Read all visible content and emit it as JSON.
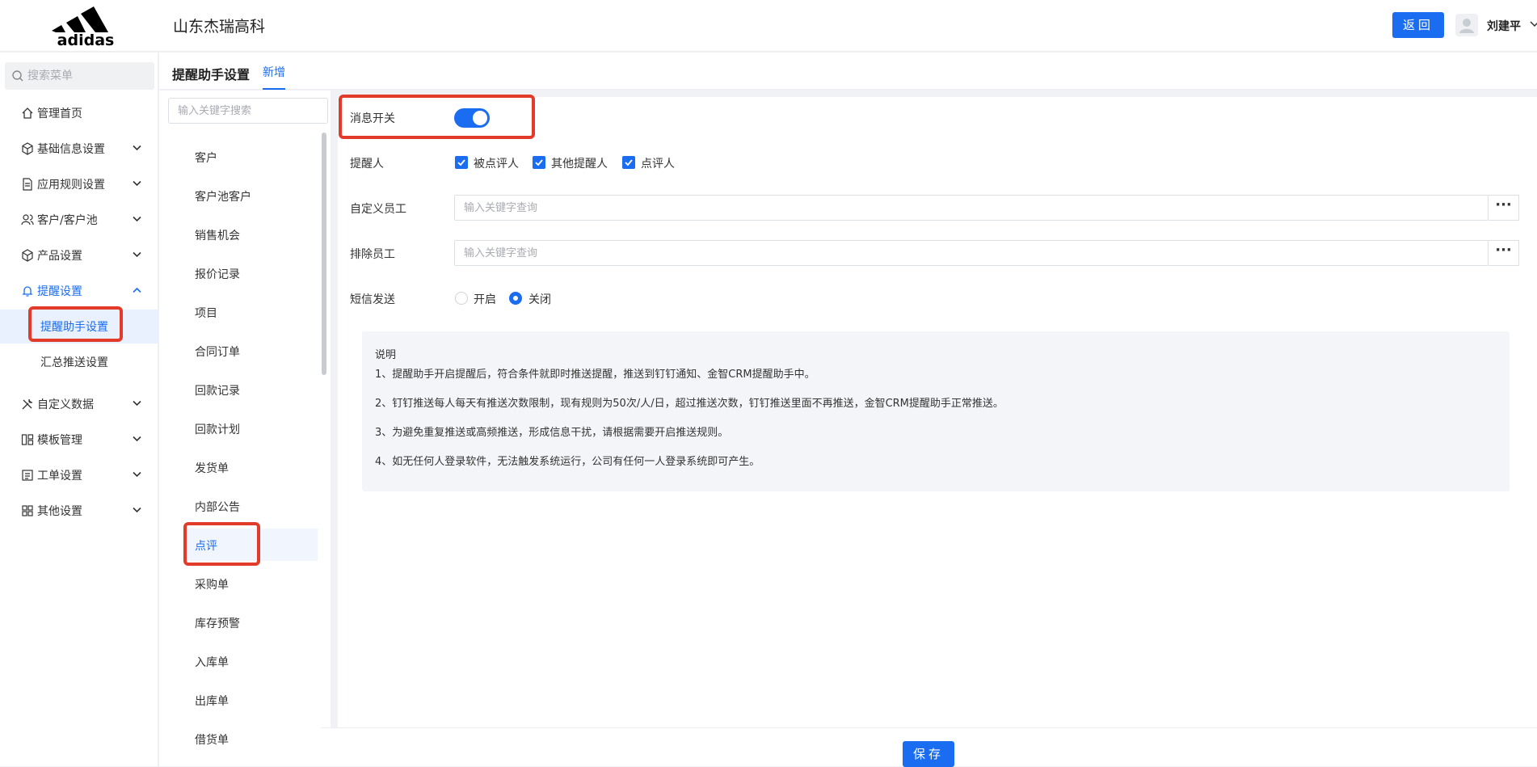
{
  "brand": {
    "logo_text": "adidas",
    "company": "山东杰瑞高科",
    "accent_color": "#1a6cf0"
  },
  "header": {
    "back_label": "返回",
    "user_name": "刘建平"
  },
  "sidebar": {
    "search_placeholder": "搜索菜单",
    "items": [
      {
        "label": "管理首页",
        "icon": "home-icon"
      },
      {
        "label": "基础信息设置",
        "icon": "cube-icon"
      },
      {
        "label": "应用规则设置",
        "icon": "document-icon"
      },
      {
        "label": "客户/客户池",
        "icon": "users-icon"
      },
      {
        "label": "产品设置",
        "icon": "box-icon"
      },
      {
        "label": "提醒设置",
        "icon": "bell-icon"
      },
      {
        "label": "自定义数据",
        "icon": "tools-icon"
      },
      {
        "label": "模板管理",
        "icon": "template-icon"
      },
      {
        "label": "工单设置",
        "icon": "form-icon"
      },
      {
        "label": "其他设置",
        "icon": "grid-icon"
      }
    ],
    "sub_items": [
      {
        "label": "提醒助手设置"
      },
      {
        "label": "汇总推送设置"
      }
    ]
  },
  "page": {
    "title": "提醒助手设置",
    "tab_new": "新增"
  },
  "modules": {
    "search_placeholder": "输入关键字搜索",
    "items": [
      "客户",
      "客户池客户",
      "销售机会",
      "报价记录",
      "项目",
      "合同订单",
      "回款记录",
      "回款计划",
      "发货单",
      "内部公告",
      "点评",
      "采购单",
      "库存预警",
      "入库单",
      "出库单",
      "借货单"
    ],
    "selected": "点评"
  },
  "form": {
    "message_switch_label": "消息开关",
    "message_switch_on": true,
    "reminder_label": "提醒人",
    "reminder_options": [
      {
        "label": "被点评人",
        "checked": true
      },
      {
        "label": "其他提醒人",
        "checked": true
      },
      {
        "label": "点评人",
        "checked": true
      }
    ],
    "custom_staff_label": "自定义员工",
    "custom_staff_placeholder": "输入关键字查询",
    "exclude_staff_label": "排除员工",
    "exclude_staff_placeholder": "输入关键字查询",
    "more_label": "···",
    "sms_label": "短信发送",
    "sms_options": [
      {
        "label": "开启",
        "selected": false
      },
      {
        "label": "关闭",
        "selected": true
      }
    ]
  },
  "notes": {
    "title": "说明",
    "lines": [
      "1、提醒助手开启提醒后，符合条件就即时推送提醒，推送到钉钉通知、金智CRM提醒助手中。",
      "2、钉钉推送每人每天有推送次数限制，现有规则为50次/人/日，超过推送次数，钉钉推送里面不再推送，金智CRM提醒助手正常推送。",
      "3、为避免重复推送或高频推送，形成信息干扰，请根据需要开启推送规则。",
      "4、如无任何人登录软件，无法触发系统运行，公司有任何一人登录系统即可产生。"
    ]
  },
  "footer": {
    "save_label": "保存"
  }
}
